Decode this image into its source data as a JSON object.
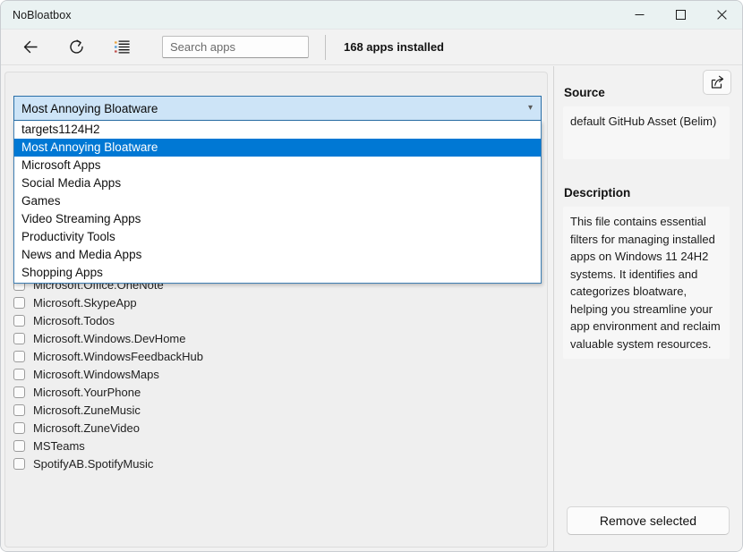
{
  "window": {
    "title": "NoBloatbox",
    "controls": {
      "minimize": "—",
      "maximize": "□",
      "close": "✕"
    }
  },
  "toolbar": {
    "back_icon": "back-arrow-icon",
    "refresh_icon": "refresh-icon",
    "list_icon": "bulleted-list-icon",
    "search_placeholder": "Search apps",
    "search_value": "",
    "apps_installed": "168 apps installed"
  },
  "filter": {
    "selected": "Most Annoying Bloatware",
    "options": [
      "targets1124H2",
      "Most Annoying Bloatware",
      "Microsoft Apps",
      "Social Media Apps",
      "Games",
      "Video Streaming Apps",
      "Productivity Tools",
      "News and Media Apps",
      "Shopping Apps"
    ],
    "selected_index": 1
  },
  "apps": [
    {
      "name": "Microsoft.Office.OneNote",
      "checked": false
    },
    {
      "name": "Microsoft.SkypeApp",
      "checked": false
    },
    {
      "name": "Microsoft.Todos",
      "checked": false
    },
    {
      "name": "Microsoft.Windows.DevHome",
      "checked": false
    },
    {
      "name": "Microsoft.WindowsFeedbackHub",
      "checked": false
    },
    {
      "name": "Microsoft.WindowsMaps",
      "checked": false
    },
    {
      "name": "Microsoft.YourPhone",
      "checked": false
    },
    {
      "name": "Microsoft.ZuneMusic",
      "checked": false
    },
    {
      "name": "Microsoft.ZuneVideo",
      "checked": false
    },
    {
      "name": "MSTeams",
      "checked": false
    },
    {
      "name": "SpotifyAB.SpotifyMusic",
      "checked": false
    }
  ],
  "sidebar": {
    "share_icon": "share-icon",
    "source_heading": "Source",
    "source_value": "default GitHub Asset (Belim)",
    "description_heading": "Description",
    "description_value": "This file contains essential filters for managing installed apps on Windows 11 24H2 systems. It identifies and categorizes bloatware, helping you streamline your app environment and reclaim valuable system resources.",
    "remove_button": "Remove selected"
  },
  "colors": {
    "titlebar": "#eaf2f2",
    "accent_selection": "#0078d4",
    "combo_background": "#cde4f7",
    "combo_border": "#2a6fa8",
    "panel": "#f2f2f2"
  }
}
